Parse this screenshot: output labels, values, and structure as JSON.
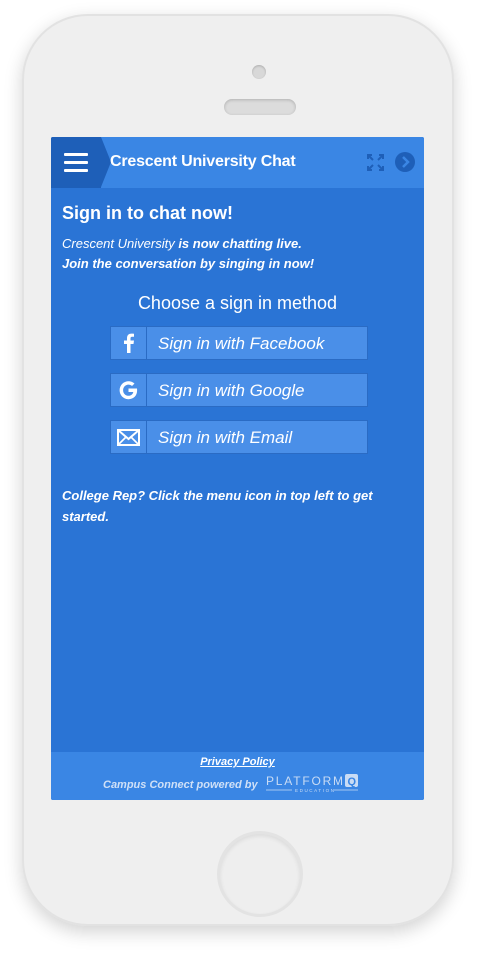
{
  "header": {
    "title": "Crescent University Chat"
  },
  "signin": {
    "heading": "Sign in to chat now!",
    "intro_school": "Crescent University",
    "intro_line1_rest": " is now chatting live.",
    "intro_line2": "Join the conversation by singing in now!",
    "choose_label": "Choose a sign in method",
    "buttons": [
      {
        "label": "Sign in with Facebook",
        "icon": "facebook-icon"
      },
      {
        "label": "Sign in with Google",
        "icon": "google-icon"
      },
      {
        "label": "Sign in with Email",
        "icon": "mail-icon"
      }
    ],
    "rep_note": "College Rep? Click the menu icon in top left to get started."
  },
  "footer": {
    "privacy_label": "Privacy Policy",
    "powered_by": "Campus Connect powered by",
    "brand_name": "PLATFORM",
    "brand_letter": "Q",
    "brand_sub": "EDUCATION"
  },
  "colors": {
    "screen_bg": "#2a74d5",
    "header_bg": "#3a86e4",
    "menu_bg": "#1e5fb8",
    "button_bg": "#4a8fe8"
  }
}
